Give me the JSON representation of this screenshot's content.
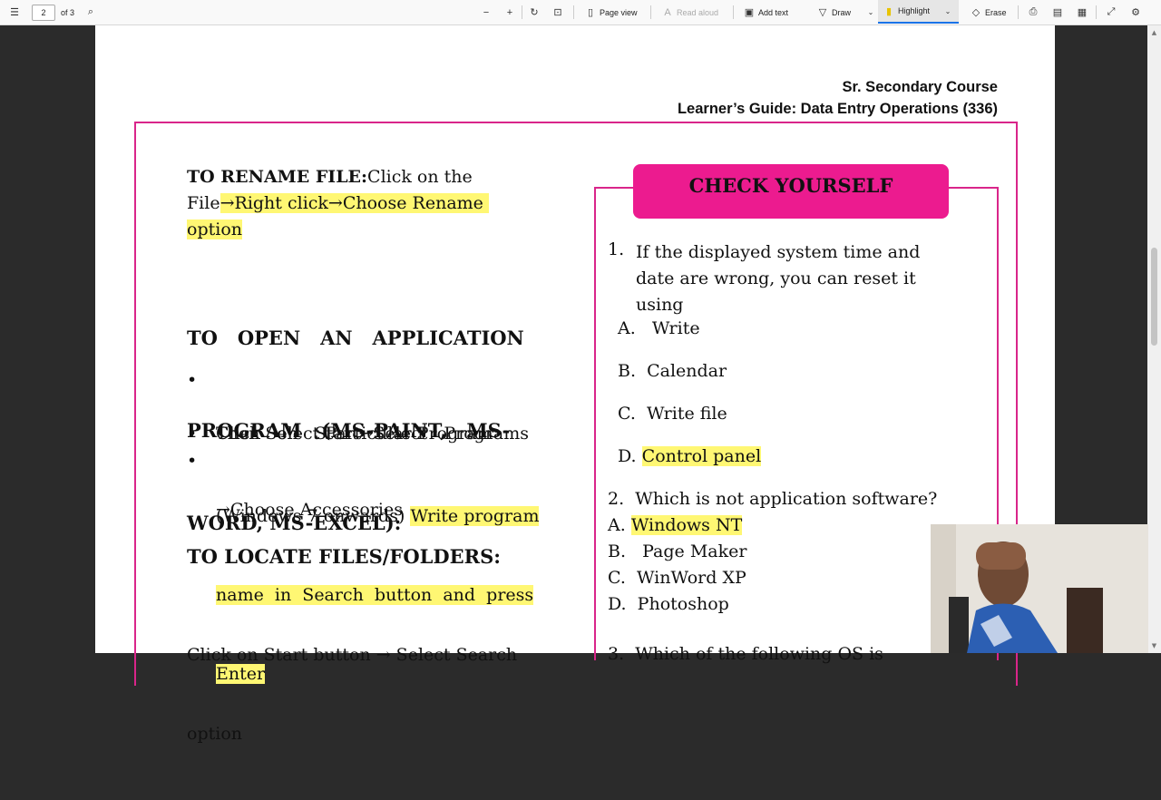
{
  "toolbar": {
    "page_number": "2",
    "page_total": "of 3",
    "page_view": "Page view",
    "read_aloud": "Read aloud",
    "add_text": "Add text",
    "draw": "Draw",
    "highlight": "Highlight",
    "erase": "Erase"
  },
  "document": {
    "header_line1": "Sr. Secondary Course",
    "header_line2": "Learner’s Guide:  Data Entry Operations (336)",
    "rename": {
      "heading": "TO RENAME FILE:",
      "text_a": "Click on the",
      "text_b": "File",
      "arrow": "→",
      "highlight_a": "Right click",
      "highlight_b": "Choose Rename",
      "highlight_c": "option"
    },
    "open_app": {
      "line1": "TO   OPEN   AN   APPLICATION",
      "line2": "PROGRAM   (MS-PAINT,   MS-",
      "line3": "WORD, MS-EXCEL):"
    },
    "bullets": {
      "b1_line1": "Click   on   Start→Select   Programs",
      "b1_line2": "→Choose Accessories",
      "b2": "Then Select Particular Program",
      "b3_plain": "(Windows 7 onwards)",
      "b3_hl1": "Write program",
      "b3_hl2": "name  in  Search  button  and  press",
      "b3_hl3": "Enter"
    },
    "locate": {
      "heading": "TO LOCATE FILES/FOLDERS:",
      "line1": "Click on Start button → Select Search",
      "line2": "option"
    },
    "check_yourself": {
      "title": "CHECK YOURSELF",
      "q1_num": "1.",
      "q1_line1": "If the displayed system time and",
      "q1_line2": "date are wrong, you can reset it",
      "q1_line3": "using",
      "q1_a": "A.   Write",
      "q1_b": "B.  Calendar",
      "q1_c": "C.  Write file",
      "q1_d_label": "D.",
      "q1_d": "Control panel",
      "q2": "2.  Which is not application software?",
      "q2_a_label": "A.",
      "q2_a": "Windows NT",
      "q2_b": "B.   Page Maker",
      "q2_c": "C.  WinWord XP",
      "q2_d": "D.  Photoshop",
      "q3_partial": "3.  Which of the following OS is"
    }
  },
  "colors": {
    "accent_magenta": "#ec1b8f",
    "frame_magenta": "#d9258a",
    "highlight_yellow": "#fff773"
  }
}
